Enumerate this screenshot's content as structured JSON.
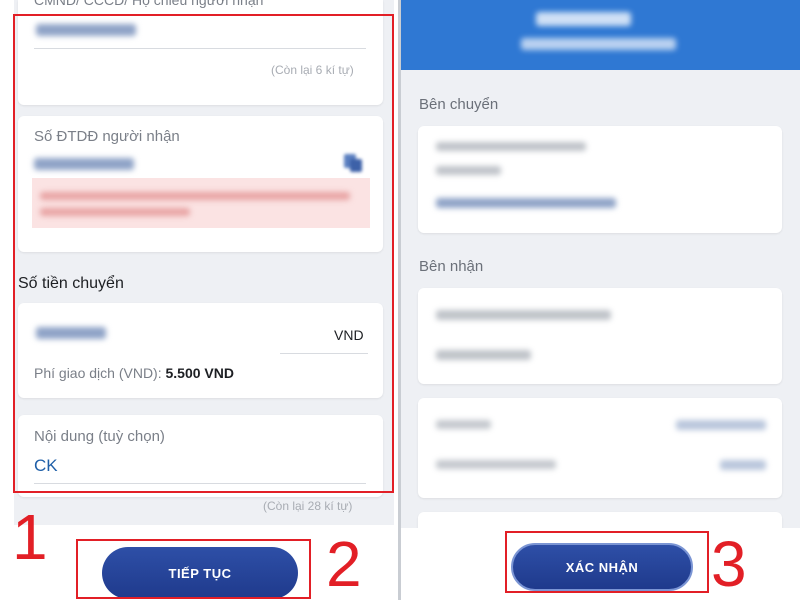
{
  "left": {
    "id_field": {
      "label": "CMND/ CCCD/ Hộ chiếu người nhận",
      "counter": "(Còn lại 6 kí tự)"
    },
    "phone_field": {
      "label": "Số ĐTDĐ người nhận"
    },
    "amount_section": {
      "title": "Số tiền chuyển",
      "unit": "VND",
      "fee_label": "Phí giao dịch (VND):",
      "fee_value": "5.500 VND"
    },
    "content_field": {
      "label": "Nội dung (tuỳ chọn)",
      "value": "CK",
      "counter": "(Còn lại 28 kí tự)"
    },
    "continue_button": "TIẾP TỤC"
  },
  "right": {
    "sender_label": "Bên chuyển",
    "receiver_label": "Bên nhận",
    "confirm_button": "XÁC NHẬN"
  },
  "annotations": {
    "step1": "1",
    "step2": "2",
    "step3": "3"
  },
  "colors": {
    "annotation_red": "#e21f26",
    "primary_button": "#2a4a9e",
    "header_blue": "#2f78d3",
    "content_blue": "#1f5fa8"
  }
}
